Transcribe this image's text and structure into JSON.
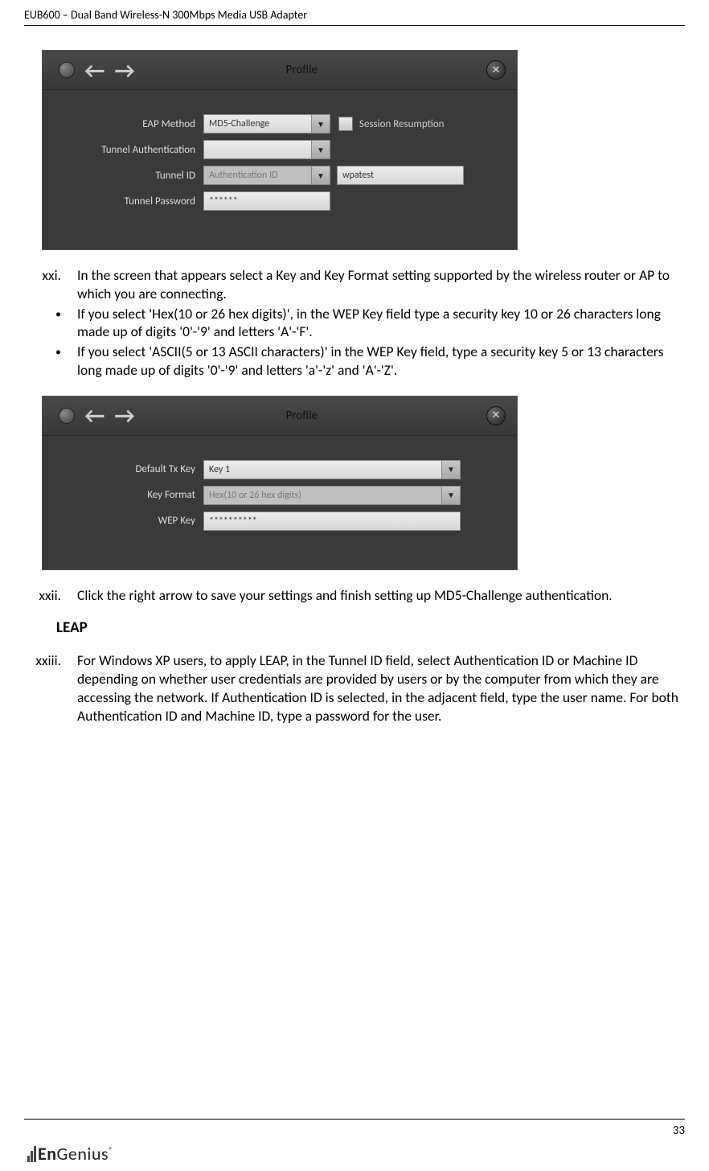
{
  "header": {
    "title": "EUB600 – Dual Band Wireless-N 300Mbps Media USB Adapter"
  },
  "dialog1": {
    "title": "Profile",
    "rows": {
      "eap_method": {
        "label": "EAP Method",
        "value": "MD5-Challenge"
      },
      "session_resumption": {
        "label": "Session Resumption"
      },
      "tunnel_auth": {
        "label": "Tunnel Authentication",
        "value": ""
      },
      "tunnel_id": {
        "label": "Tunnel ID",
        "value": "Authentication ID",
        "adj_value": "wpatest"
      },
      "tunnel_password": {
        "label": "Tunnel Password",
        "value": "******"
      }
    }
  },
  "instructions": {
    "xxi": "In the screen that appears select a Key and Key Format setting supported by the wireless router or AP to which you are connecting.",
    "bullet1": "If you select 'Hex(10 or 26 hex digits)', in the WEP Key field type a security key 10 or 26 characters long made up of digits '0'-'9' and letters 'A'-'F'.",
    "bullet2": "If you select 'ASCII(5 or 13 ASCII characters)' in the WEP Key field, type a security key 5 or 13 characters long made up of digits '0'-'9' and letters 'a'-'z' and 'A'-'Z'.",
    "xxii": "Click the right arrow to save your settings and finish setting up MD5-Challenge authentication.",
    "xxiii": "For Windows XP users, to apply LEAP, in the Tunnel ID field, select Authentication ID or Machine ID depending on whether user credentials are provided by users or by the computer from which they are accessing the network. If Authentication ID is selected, in the adjacent field, type the user name. For both Authentication ID and Machine ID, type a password for the user."
  },
  "markers": {
    "xxi": "xxi.",
    "xxii": "xxii.",
    "xxiii": "xxiii.",
    "bullet": "•"
  },
  "dialog2": {
    "title": "Profile",
    "rows": {
      "default_tx": {
        "label": "Default Tx Key",
        "value": "Key 1"
      },
      "key_format": {
        "label": "Key Format",
        "value": "Hex(10 or 26 hex digits)"
      },
      "wep_key": {
        "label": "WEP Key",
        "value": "**********"
      }
    }
  },
  "section": {
    "leap": "LEAP"
  },
  "footer": {
    "page": "33",
    "logo_prefix": "En",
    "logo_suffix": "Genius",
    "reg": "®"
  }
}
